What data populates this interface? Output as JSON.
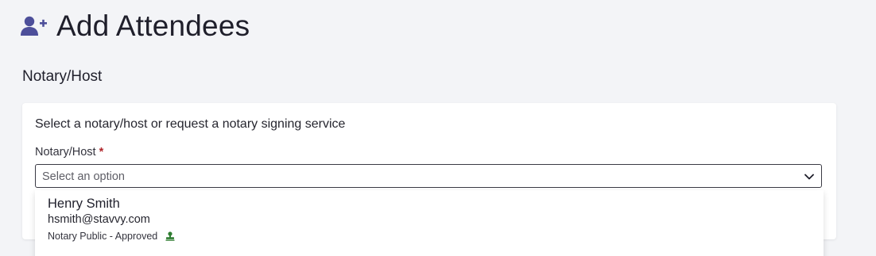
{
  "header": {
    "title": "Add Attendees",
    "icon": "add-user-icon",
    "icon_color": "#4d4f9a"
  },
  "section": {
    "title": "Notary/Host"
  },
  "card": {
    "description": "Select a notary/host or request a notary signing service",
    "field": {
      "label": "Notary/Host",
      "required_marker": "*",
      "placeholder": "Select an option",
      "icon": "chevron-down-icon"
    }
  },
  "dropdown": {
    "options": [
      {
        "name": "Henry Smith",
        "email": "hsmith@stavvy.com",
        "role": "Notary Public - Approved",
        "badge_icon": "stamp-icon",
        "badge_color": "#2f7d32"
      }
    ]
  },
  "colors": {
    "background": "#f3f4f7",
    "required": "#b0262b"
  }
}
